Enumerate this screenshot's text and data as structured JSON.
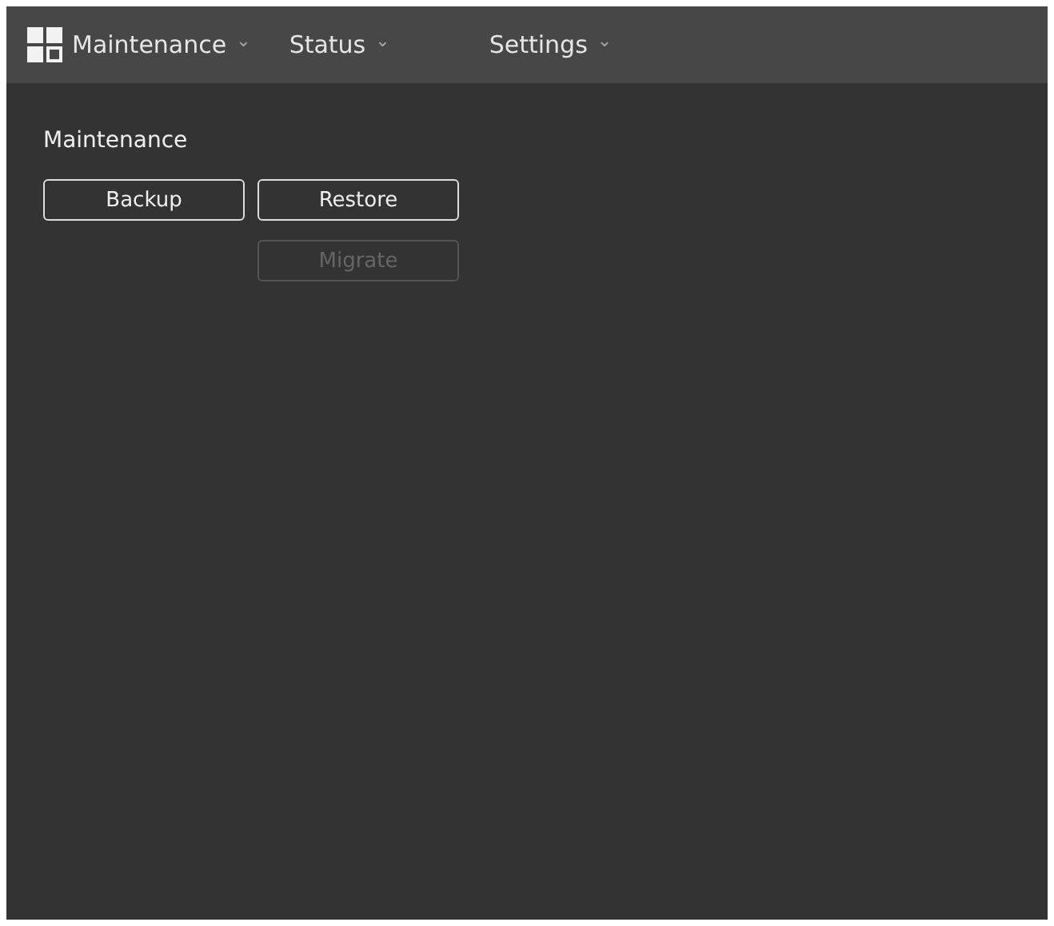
{
  "menu_bar": {
    "items": [
      {
        "label": "Maintenance",
        "chevron": "⌄",
        "has_icon": true
      },
      {
        "label": "Status",
        "chevron": "⌄",
        "has_icon": false
      },
      {
        "label": "Settings",
        "chevron": "⌄",
        "has_icon": false
      }
    ]
  },
  "section": {
    "title": "Maintenance",
    "columns": [
      {
        "buttons": [
          {
            "label": "Backup",
            "disabled": false
          }
        ]
      },
      {
        "buttons": [
          {
            "label": "Restore",
            "disabled": false
          },
          {
            "label": "Migrate",
            "disabled": true
          }
        ]
      }
    ]
  }
}
